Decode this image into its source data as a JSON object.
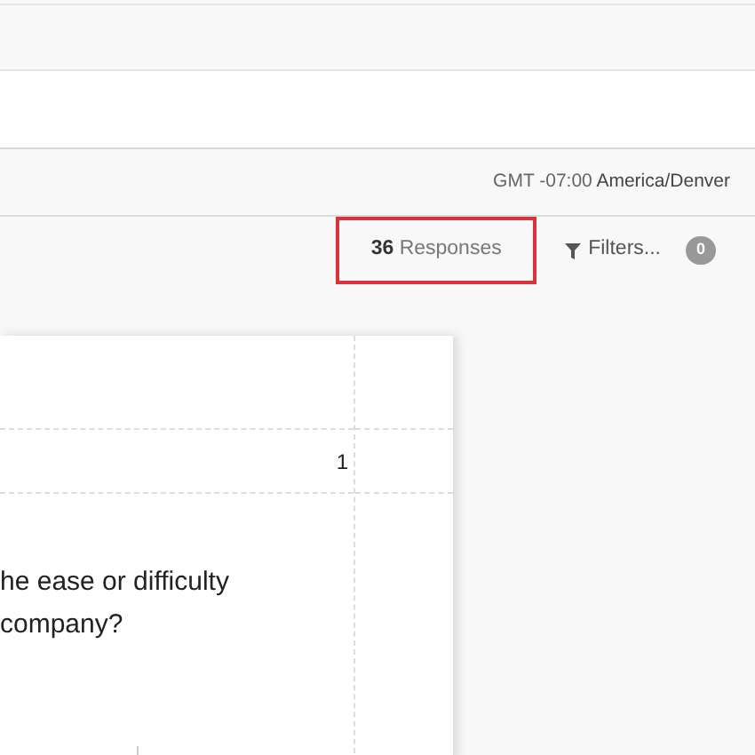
{
  "timezone": {
    "offset": "GMT -07:00",
    "zone": "America/Denver"
  },
  "toolbar": {
    "responses": {
      "count": "36",
      "label": "Responses",
      "highlighted": true
    },
    "filters": {
      "label": "Filters...",
      "count": "0"
    }
  },
  "report": {
    "row_value": "1",
    "question_lines": [
      "he ease or difficulty",
      "company?"
    ]
  }
}
